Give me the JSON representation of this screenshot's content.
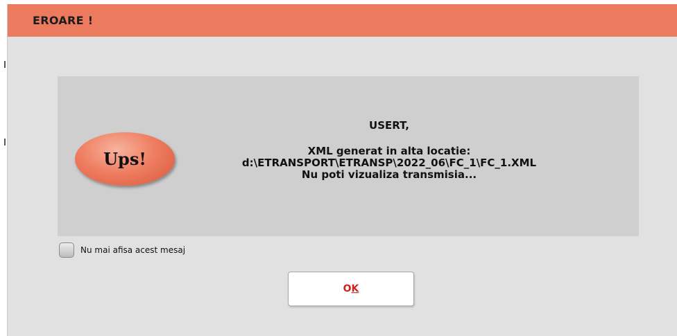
{
  "window": {
    "title": "EROARE !",
    "title_bar_color": "#ec7a5f",
    "background_color": "#e1e1e1"
  },
  "message_panel": {
    "badge_text": "Ups!",
    "badge_color": "#ef7f62",
    "greeting": "USERT,",
    "lines": [
      "XML generat in alta locatie:",
      "d:\\ETRANSPORT\\ETRANSP\\2022_06\\FC_1\\FC_1.XML",
      "Nu poti vizualiza transmisia..."
    ]
  },
  "checkbox": {
    "label": "Nu mai afisa acest mesaj",
    "checked": false
  },
  "ok_button": {
    "label_part1": "O",
    "label_part2": "K",
    "text_color": "#d2231a"
  }
}
